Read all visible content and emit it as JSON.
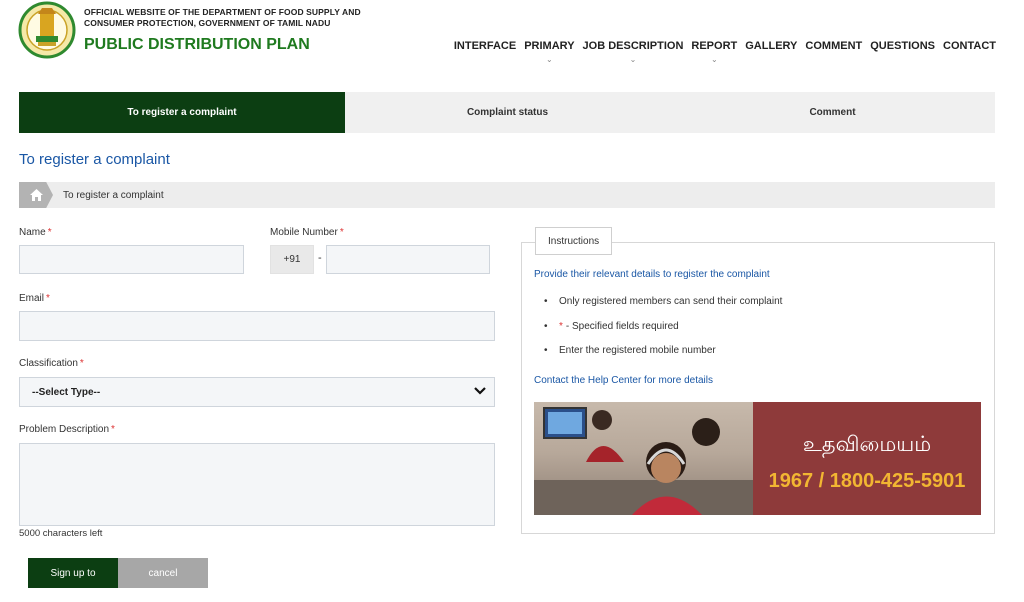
{
  "header": {
    "official_line1": "OFFICIAL WEBSITE OF THE DEPARTMENT OF FOOD SUPPLY AND",
    "official_line2": "CONSUMER PROTECTION, GOVERNMENT OF TAMIL NADU",
    "site_title": "PUBLIC DISTRIBUTION PLAN",
    "logo_icon": "tamil-nadu-emblem-icon"
  },
  "nav": {
    "items": [
      {
        "label": "INTERFACE",
        "has_dropdown": false
      },
      {
        "label": "PRIMARY",
        "has_dropdown": true
      },
      {
        "label": "JOB DESCRIPTION",
        "has_dropdown": true
      },
      {
        "label": "REPORT",
        "has_dropdown": true
      },
      {
        "label": "GALLERY",
        "has_dropdown": false
      },
      {
        "label": "COMMENT",
        "has_dropdown": false
      },
      {
        "label": "QUESTIONS",
        "has_dropdown": false
      },
      {
        "label": "CONTACT",
        "has_dropdown": false
      }
    ]
  },
  "tabs": [
    {
      "label": "To register a complaint",
      "active": true
    },
    {
      "label": "Complaint status",
      "active": false
    },
    {
      "label": "Comment",
      "active": false
    }
  ],
  "page": {
    "title": "To register a complaint",
    "breadcrumb": "To register a complaint"
  },
  "form": {
    "name_label": "Name",
    "mobile_label": "Mobile Number",
    "mobile_prefix": "+91",
    "mobile_dash": "-",
    "email_label": "Email",
    "classification_label": "Classification",
    "classification_selected": "--Select Type--",
    "problem_label": "Problem Description",
    "required_mark": "*",
    "chars_left": "5000 characters left",
    "submit_label": "Sign up to",
    "cancel_label": "cancel"
  },
  "instructions": {
    "legend": "Instructions",
    "lead": "Provide their relevant details to register the complaint",
    "items": [
      {
        "text": "Only registered members can send their complaint",
        "star": ""
      },
      {
        "text": "- Specified fields required",
        "star": "*"
      },
      {
        "text": "Enter the registered mobile number",
        "star": ""
      }
    ],
    "help_link": "Contact the Help Center for more details"
  },
  "banner": {
    "tamil_text": "உதவிமையம்",
    "phone": "1967 / 1800-425-5901"
  },
  "colors": {
    "primary_green": "#0c3e12",
    "title_green": "#1f7a1f",
    "link_blue": "#1a57a5",
    "required_red": "#d33333",
    "banner_red": "#8e3a3a",
    "banner_gold": "#f2b632"
  }
}
